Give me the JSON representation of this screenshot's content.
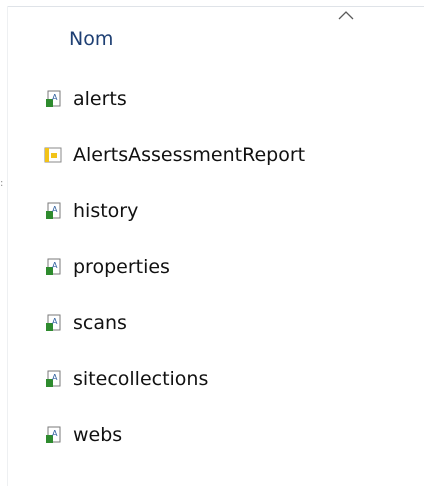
{
  "header": {
    "column_label": "Nom"
  },
  "items": [
    {
      "label": "alerts",
      "icon": "xml-file-icon"
    },
    {
      "label": "AlertsAssessmentReport",
      "icon": "report-file-icon"
    },
    {
      "label": "history",
      "icon": "xml-file-icon"
    },
    {
      "label": "properties",
      "icon": "xml-file-icon"
    },
    {
      "label": "scans",
      "icon": "xml-file-icon"
    },
    {
      "label": "sitecollections",
      "icon": "xml-file-icon"
    },
    {
      "label": "webs",
      "icon": "xml-file-icon"
    }
  ],
  "colors": {
    "header_text": "#1e3f73",
    "item_text": "#111111",
    "xml_icon_green": "#2e8b2e",
    "report_icon_yellow": "#f2c318"
  }
}
